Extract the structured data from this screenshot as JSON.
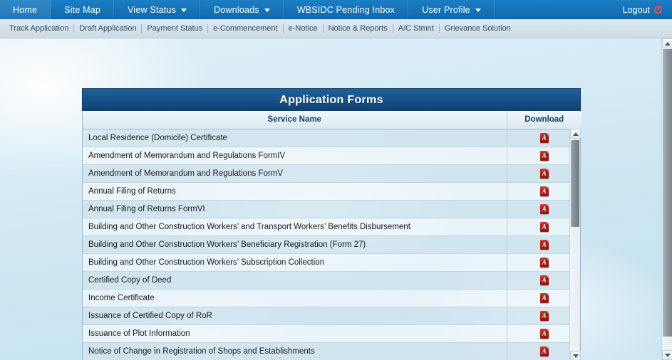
{
  "topnav": {
    "items": [
      {
        "label": "Home",
        "has_caret": false
      },
      {
        "label": "Site Map",
        "has_caret": false
      },
      {
        "label": "View Status",
        "has_caret": true
      },
      {
        "label": "Downloads",
        "has_caret": true
      },
      {
        "label": "WBSIDC Pending Inbox",
        "has_caret": false
      },
      {
        "label": "User Profile",
        "has_caret": true
      }
    ],
    "logout_label": "Logout",
    "logout_icon": "power-icon",
    "bg_color": "#1774b8",
    "text_color": "#ffffff"
  },
  "subnav": {
    "items": [
      "Track Application",
      "Draft Application",
      "Payment Status",
      "e-Commencement",
      "e-Notice",
      "Notice & Reports",
      "A/C Stmnt",
      "Grievance Solution"
    ],
    "text_color": "#2a4a63"
  },
  "panel": {
    "title": "Application Forms",
    "title_bg": "#18548b",
    "columns": [
      "Service Name",
      "Download"
    ],
    "download_icon": "pdf-icon",
    "rows": [
      {
        "service": "Local Residence (Domicile) Certificate",
        "download": "pdf-icon"
      },
      {
        "service": "Amendment of Memorandum and Regulations FormIV",
        "download": "pdf-icon"
      },
      {
        "service": "Amendment of Memorandum and Regulations FormV",
        "download": "pdf-icon"
      },
      {
        "service": "Annual Filing of Returns",
        "download": "pdf-icon"
      },
      {
        "service": "Annual Filing of Returns FormVI",
        "download": "pdf-icon"
      },
      {
        "service": "Building and Other Construction Workers’ and Transport Workers’ Benefits Disbursement",
        "download": "pdf-icon"
      },
      {
        "service": "Building and Other Construction Workers’ Beneficiary Registration (Form 27)",
        "download": "pdf-icon"
      },
      {
        "service": "Building and Other Construction Workers’ Subscription Collection",
        "download": "pdf-icon"
      },
      {
        "service": "Certified Copy of Deed",
        "download": "pdf-icon"
      },
      {
        "service": "Income Certificate",
        "download": "pdf-icon"
      },
      {
        "service": "Issuance of Certified Copy of RoR",
        "download": "pdf-icon"
      },
      {
        "service": "Issuance of Plot Information",
        "download": "pdf-icon"
      },
      {
        "service": "Notice of Change in Registration of Shops and Establishments",
        "download": "pdf-icon"
      }
    ]
  }
}
